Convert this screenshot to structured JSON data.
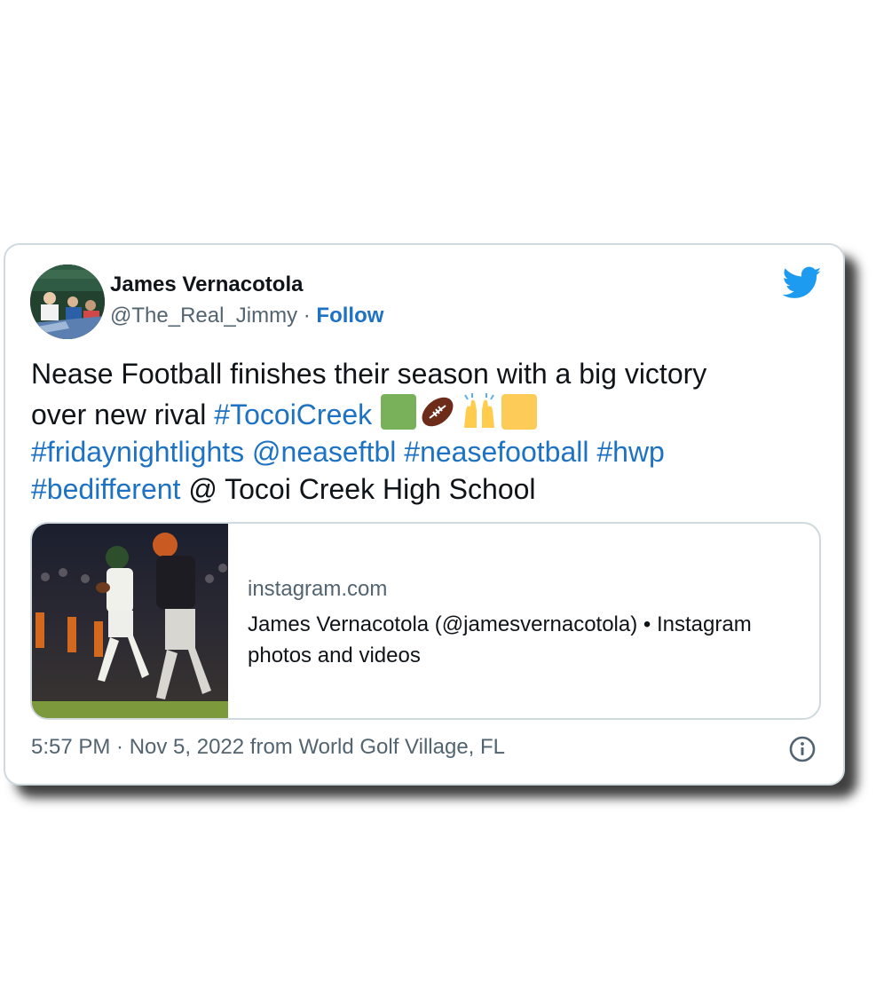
{
  "author": {
    "name": "James Vernacotola",
    "handle": "@The_Real_Jimmy",
    "separator": " · ",
    "follow_label": "Follow"
  },
  "tweet": {
    "line1": "Nease Football finishes their season with a big victory",
    "line2_text": "over new rival ",
    "tag_tocoi": "#TocoiCreek",
    "tag_friday": "#fridaynightlights",
    "mention_nease": "@neaseftbl",
    "tag_neasefootball": "#neasefootball",
    "tag_hwp": "#hwp",
    "tag_bedifferent": "#bedifferent",
    "location_text": " @ Tocoi Creek High School",
    "emojis": [
      "green-square",
      "american-football",
      "raising-hands",
      "yellow-square"
    ]
  },
  "link_card": {
    "domain": "instagram.com",
    "title": "James Vernacotola (@jamesvernacotola) • Instagram photos and videos"
  },
  "meta": {
    "timestamp": "5:57 PM · Nov 5, 2022 from World Golf Village, FL"
  },
  "colors": {
    "link": "#1d72c4",
    "text": "#0f1419",
    "muted": "#536471",
    "twitter_blue": "#1d9bf0",
    "border": "#cfd9de",
    "green_square": "#78b159",
    "yellow_square": "#fdcb58"
  },
  "icons": {
    "brand": "twitter-bird-icon",
    "info": "info-icon"
  }
}
